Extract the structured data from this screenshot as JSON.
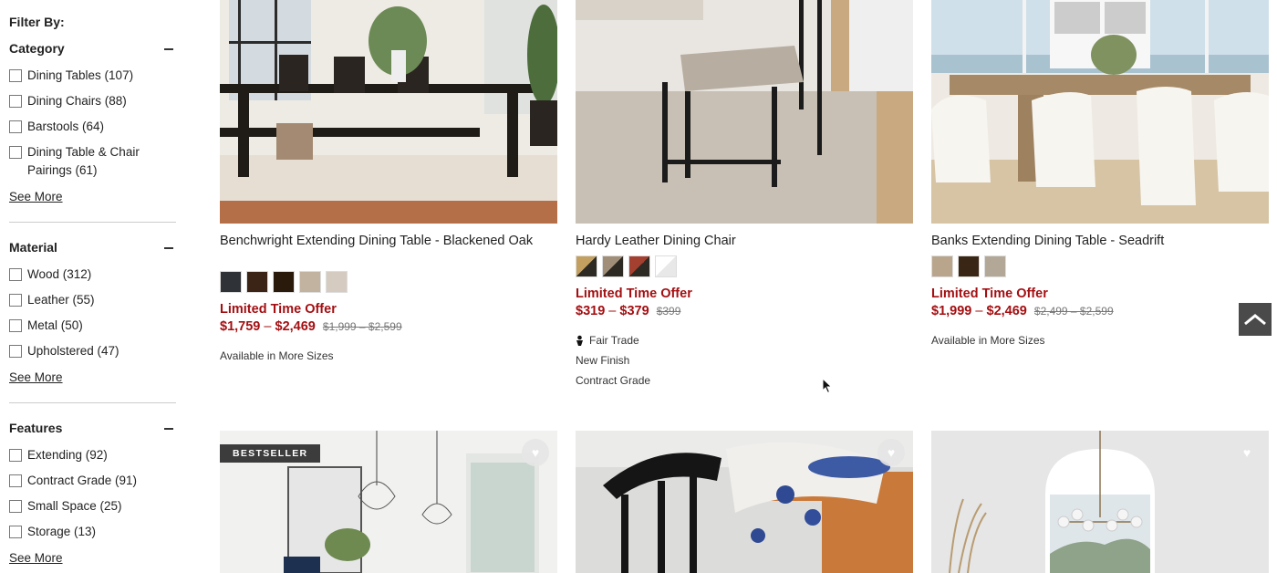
{
  "filter": {
    "heading": "Filter By:",
    "see_more": "See More",
    "sections": [
      {
        "title": "Category",
        "options": [
          "Dining Tables (107)",
          "Dining Chairs (88)",
          "Barstools (64)",
          "Dining Table & Chair Pairings (61)"
        ]
      },
      {
        "title": "Material",
        "options": [
          "Wood (312)",
          "Leather (55)",
          "Metal (50)",
          "Upholstered (47)"
        ]
      },
      {
        "title": "Features",
        "options": [
          "Extending (92)",
          "Contract Grade (91)",
          "Small Space (25)",
          "Storage (13)"
        ]
      }
    ]
  },
  "products": [
    {
      "name": "Benchwright Extending Dining Table - Blackened Oak",
      "offer": "Limited Time Offer",
      "price_low": "$1,759",
      "price_sep": "–",
      "price_high": "$2,469",
      "orig_price": "$1,999 – $2,599",
      "swatches": [
        "#2f3236",
        "#3b2415",
        "#2a1a0c",
        "#c2b3a0",
        "#d5cbc0"
      ],
      "meta": [
        "Available in More Sizes"
      ]
    },
    {
      "name": "Hardy Leather Dining Chair",
      "offer": "Limited Time Offer",
      "price_low": "$319",
      "price_sep": "–",
      "price_high": "$379",
      "orig_price": "$399",
      "swatches": [
        "#6b5a3c",
        "#5c4a3a",
        "#8a3a2a",
        "#f4f4f4"
      ],
      "meta": [
        "Fair Trade",
        "New Finish",
        "Contract Grade"
      ]
    },
    {
      "name": "Banks Extending Dining Table - Seadrift",
      "offer": "Limited Time Offer",
      "price_low": "$1,999",
      "price_sep": "–",
      "price_high": "$2,469",
      "orig_price": "$2,499 – $2,599",
      "swatches": [
        "#b8a58c",
        "#3a2614",
        "#b3a898"
      ],
      "meta": [
        "Available in More Sizes"
      ]
    }
  ],
  "bottom_row": {
    "badge": "BESTSELLER",
    "heart_icon": "heart-icon"
  }
}
